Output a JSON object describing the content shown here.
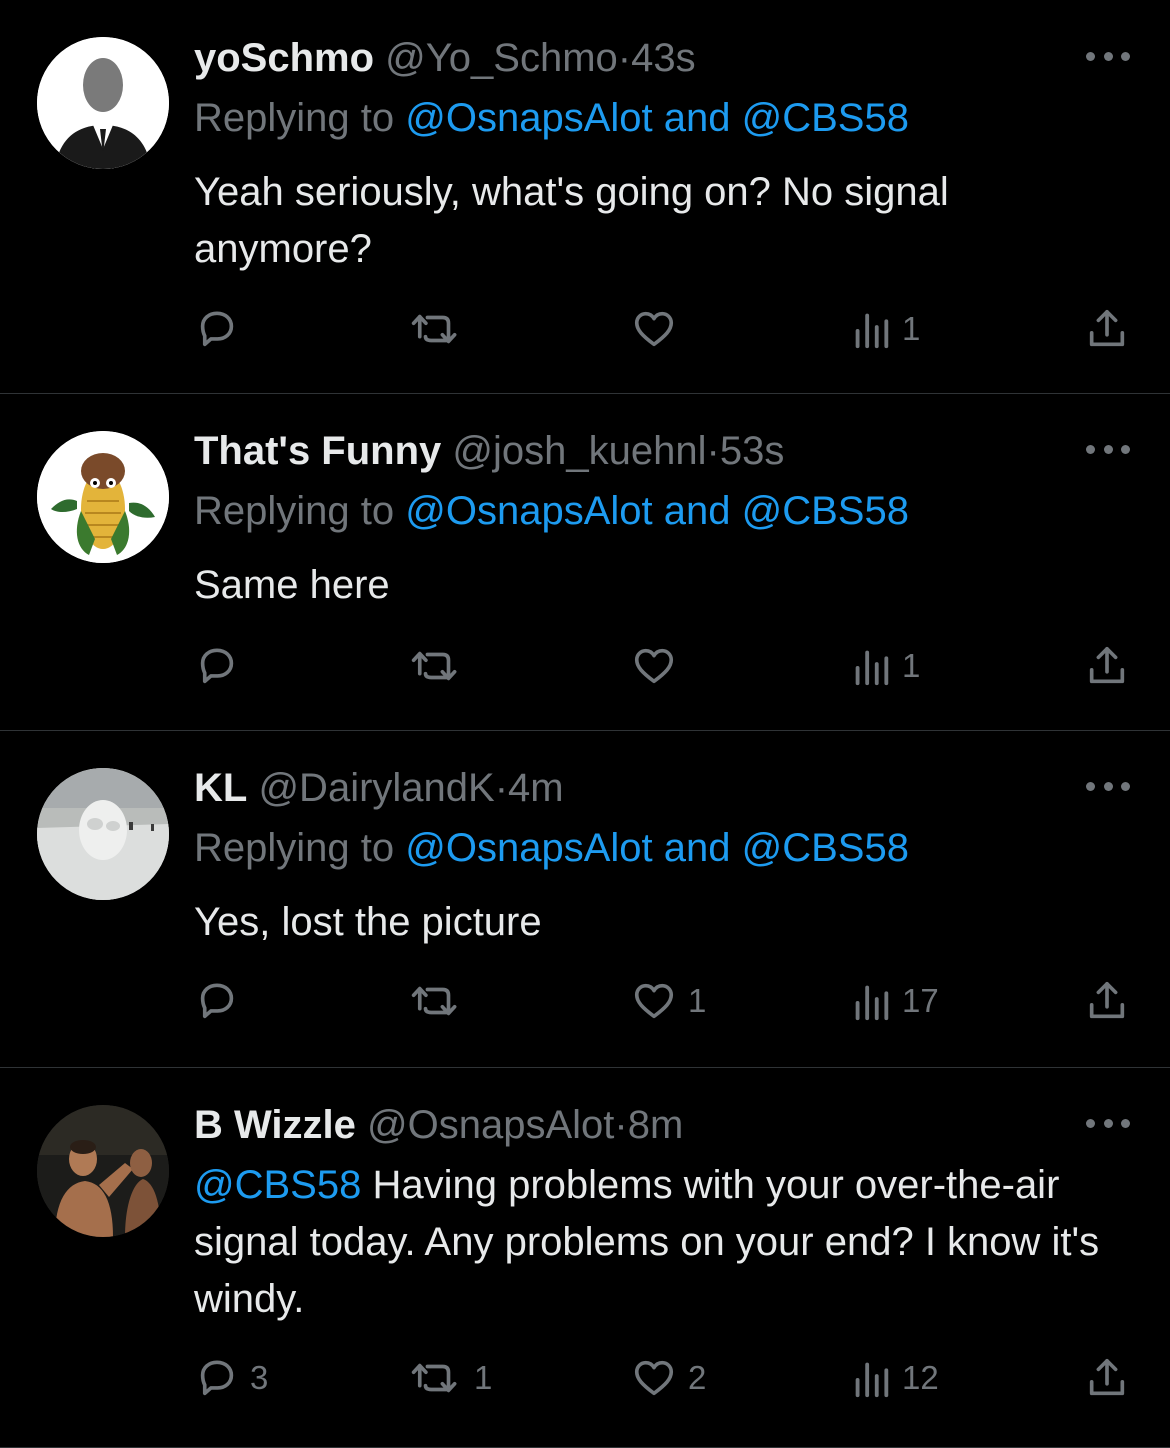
{
  "tweets": [
    {
      "name": "yoSchmo",
      "handle": "@Yo_Schmo",
      "dot": "·",
      "time": "43s",
      "replying_prefix": "Replying to",
      "replying_to": "@OsnapsAlot and @CBS58",
      "text": "Yeah seriously, what's going on? No signal anymore?",
      "replies": "",
      "retweets": "",
      "likes": "",
      "views": "1",
      "avatar_icon": "default-person-silhouette"
    },
    {
      "name": "That's Funny",
      "handle": "@josh_kuehnl",
      "dot": "·",
      "time": "53s",
      "replying_prefix": "Replying to",
      "replying_to": "@OsnapsAlot and @CBS58",
      "text": "Same here",
      "replies": "",
      "retweets": "",
      "likes": "",
      "views": "1",
      "avatar_icon": "corn-mascot"
    },
    {
      "name": "KL",
      "handle": "@DairylandK",
      "dot": "·",
      "time": "4m",
      "replying_prefix": "Replying to",
      "replying_to": "@OsnapsAlot and @CBS58",
      "text": "Yes, lost the picture",
      "replies": "",
      "retweets": "",
      "likes": "1",
      "views": "17",
      "avatar_icon": "snow-sculpture"
    },
    {
      "name": "B Wizzle",
      "handle": "@OsnapsAlot",
      "dot": "·",
      "time": "8m",
      "mention": "@CBS58",
      "text": " Having problems with your over-the-air signal today.  Any problems on your end? I know it's windy.",
      "replies": "3",
      "retweets": "1",
      "likes": "2",
      "views": "12",
      "avatar_icon": "fighter-photo"
    }
  ],
  "colors": {
    "background": "#000000",
    "text": "#e7e9ea",
    "muted": "#71767b",
    "link": "#1d9bf0",
    "divider": "#2f3336"
  },
  "icons": {
    "reply": "reply-icon",
    "retweet": "retweet-icon",
    "like": "like-icon",
    "views": "views-icon",
    "share": "share-icon",
    "more": "more-icon"
  }
}
